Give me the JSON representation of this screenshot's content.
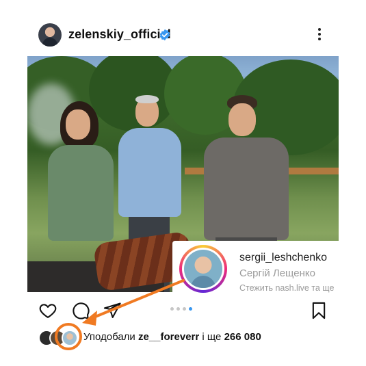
{
  "post": {
    "username": "zelenskiy_official",
    "verified": true,
    "more_icon": "more-vertical-icon"
  },
  "tag_card": {
    "username": "sergii_leshchenko",
    "display_name": "Сергій Лещенко",
    "followed_by": "Стежить nash.live та ще"
  },
  "carousel": {
    "dot_count": 4,
    "active_index": 3,
    "active_color": "#3897f0"
  },
  "actions": {
    "like_icon": "heart-icon",
    "comment_icon": "comment-icon",
    "share_icon": "send-icon",
    "save_icon": "bookmark-icon"
  },
  "likes": {
    "prefix": "Уподобали ",
    "liker": "ze__foreverr",
    "suffix": " і ще ",
    "count": "266 080"
  },
  "annotation": {
    "arrow_color": "#f07a22"
  }
}
